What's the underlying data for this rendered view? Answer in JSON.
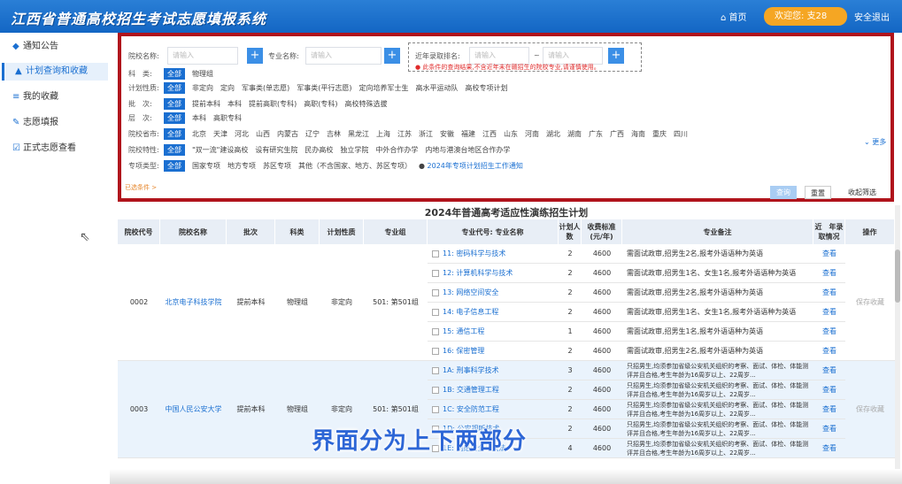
{
  "header": {
    "title": "江西省普通高校招生考试志愿填报系统",
    "home": "首页",
    "welcome": "欢迎您:",
    "user": "支28",
    "logout": "安全退出"
  },
  "sidebar": [
    "通知公告",
    "计划查询和收藏",
    "我的收藏",
    "志愿填报",
    "正式志愿查看"
  ],
  "filters": {
    "school_label": "院校名称:",
    "school_ph": "请输入",
    "major_label": "专业名称:",
    "major_ph": "请输入",
    "rank_label": "近年录取排名:",
    "rank_ph1": "请输入",
    "rank_ph2": "请输入",
    "tilde": "~",
    "warning": "此条件的查询结果,不含近年未在赣招生的院校专业,请谨慎使用。",
    "rows": [
      {
        "label": "科　类:",
        "options": [
          "全部",
          "物理组"
        ]
      },
      {
        "label": "计划性质:",
        "options": [
          "全部",
          "非定向",
          "定向",
          "军事类(单志愿)",
          "军事类(平行志愿)",
          "定向培养军士生",
          "高水平运动队",
          "高校专项计划"
        ]
      },
      {
        "label": "批　次:",
        "options": [
          "全部",
          "提前本科",
          "本科",
          "提前高职(专科)",
          "高职(专科)",
          "高校特殊选拔"
        ]
      },
      {
        "label": "层　次:",
        "options": [
          "全部",
          "本科",
          "高职专科"
        ]
      },
      {
        "label": "院校省市:",
        "options": [
          "全部",
          "北京",
          "天津",
          "河北",
          "山西",
          "内蒙古",
          "辽宁",
          "吉林",
          "黑龙江",
          "上海",
          "江苏",
          "浙江",
          "安徽",
          "福建",
          "江西",
          "山东",
          "河南",
          "湖北",
          "湖南",
          "广东",
          "广西",
          "海南",
          "重庆",
          "四川"
        ]
      },
      {
        "label": "院校特性:",
        "options": [
          "全部",
          "\"双一流\"建设高校",
          "设有研究生院",
          "民办高校",
          "独立学院",
          "中外合作办学",
          "内地与港澳台地区合作办学"
        ]
      },
      {
        "label": "专项类型:",
        "options": [
          "全部",
          "国家专项",
          "地方专项",
          "苏区专项",
          "其他（不含国家、地方、苏区专项）"
        ]
      }
    ],
    "notice": "2024年专项计划招生工作通知",
    "more": "更多",
    "collapse": "已选条件 >",
    "query": "查询",
    "reset": "重置",
    "collapse_filter": "收起筛选"
  },
  "table": {
    "title": "2024年普通高考适应性演练招生计划",
    "headers": [
      "院校代号",
      "院校名称",
      "批次",
      "科类",
      "计划性质",
      "专业组",
      "专业代号: 专业名称",
      "计划人数",
      "收费标准(元/年)",
      "专业备注",
      "近　年录取情况",
      "操作"
    ],
    "groups": [
      {
        "code": "0002",
        "name": "北京电子科技学院",
        "batch": "提前本科",
        "subject": "物理组",
        "nature": "非定向",
        "group": "501: 第501组",
        "action": "保存收藏",
        "rows": [
          {
            "major": "11: 密码科学与技术",
            "n": "2",
            "fee": "4600",
            "note": "需面试政审,招男生2名,报考外语语种为英语",
            "view": "查看"
          },
          {
            "major": "12: 计算机科学与技术",
            "n": "2",
            "fee": "4600",
            "note": "需面试政审,招男生1名、女生1名,报考外语语种为英语",
            "view": "查看"
          },
          {
            "major": "13: 网络空间安全",
            "n": "2",
            "fee": "4600",
            "note": "需面试政审,招男生2名,报考外语语种为英语",
            "view": "查看"
          },
          {
            "major": "14: 电子信息工程",
            "n": "2",
            "fee": "4600",
            "note": "需面试政审,招男生1名、女生1名,报考外语语种为英语",
            "view": "查看"
          },
          {
            "major": "15: 通信工程",
            "n": "1",
            "fee": "4600",
            "note": "需面试政审,招男生1名,报考外语语种为英语",
            "view": "查看"
          },
          {
            "major": "16: 保密管理",
            "n": "2",
            "fee": "4600",
            "note": "需面试政审,招男生2名,报考外语语种为英语",
            "view": "查看"
          }
        ]
      },
      {
        "code": "0003",
        "name": "中国人民公安大学",
        "batch": "提前本科",
        "subject": "物理组",
        "nature": "非定向",
        "group": "501: 第501组",
        "action": "保存收藏",
        "rows": [
          {
            "major": "1A: 刑事科学技术",
            "n": "3",
            "fee": "4600",
            "note": "只招男生,均须参加省级公安机关组织的考察、面试、体检、体能测评并且合格,考生年龄为16周岁以上、22周岁...",
            "view": "查看"
          },
          {
            "major": "1B: 交通管理工程",
            "n": "2",
            "fee": "4600",
            "note": "只招男生,均须参加省级公安机关组织的考察、面试、体检、体能测评并且合格,考生年龄为16周岁以上、22周岁...",
            "view": "查看"
          },
          {
            "major": "1C: 安全防范工程",
            "n": "2",
            "fee": "4600",
            "note": "只招男生,均须参加省级公安机关组织的考察、面试、体检、体能测评并且合格,考生年龄为16周岁以上、22周岁...",
            "view": "查看"
          },
          {
            "major": "1D: 公安视听技术",
            "n": "2",
            "fee": "4600",
            "note": "只招男生,均须参加省级公安机关组织的考察、面试、体检、体能测评并且合格,考生年龄为16周岁以上、22周岁...",
            "view": "查看"
          },
          {
            "major": "1E: 网络安全与执法",
            "n": "4",
            "fee": "4600",
            "note": "只招男生,均须参加省级公安机关组织的考察、面试、体检、体能测评并且合格,考生年龄为16周岁以上、22周岁...",
            "view": "查看"
          }
        ]
      }
    ]
  },
  "caption": "界面分为上下两部分"
}
